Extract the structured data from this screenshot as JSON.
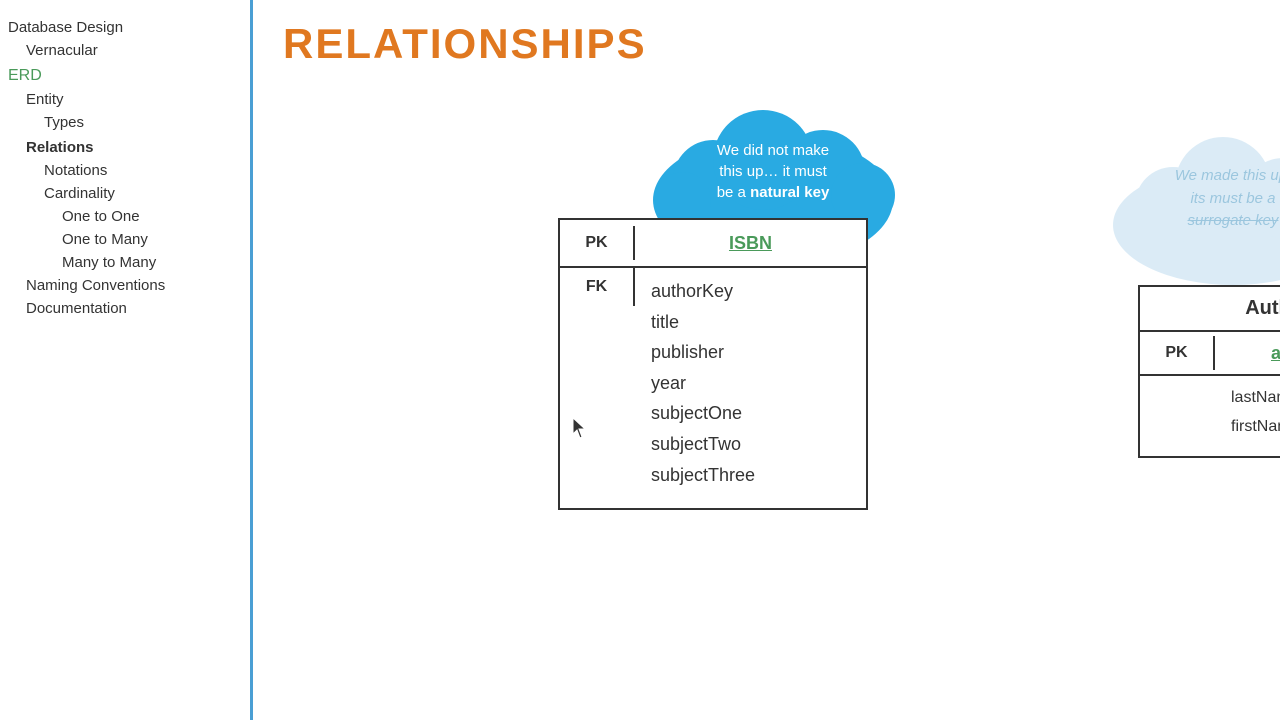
{
  "sidebar": {
    "items": [
      {
        "label": "Database Design",
        "level": 0,
        "style": "normal"
      },
      {
        "label": "Vernacular",
        "level": 1,
        "style": "normal"
      },
      {
        "label": "ERD",
        "level": 0,
        "style": "green"
      },
      {
        "label": "Entity",
        "level": 1,
        "style": "normal"
      },
      {
        "label": "Types",
        "level": 2,
        "style": "normal"
      },
      {
        "label": "Relations",
        "level": 1,
        "style": "active"
      },
      {
        "label": "Notations",
        "level": 2,
        "style": "normal"
      },
      {
        "label": "Cardinality",
        "level": 2,
        "style": "normal"
      },
      {
        "label": "One to One",
        "level": 3,
        "style": "normal"
      },
      {
        "label": "One to Many",
        "level": 3,
        "style": "normal"
      },
      {
        "label": "Many to Many",
        "level": 3,
        "style": "normal"
      },
      {
        "label": "Naming Conventions",
        "level": 1,
        "style": "normal"
      },
      {
        "label": "Documentation",
        "level": 1,
        "style": "normal"
      }
    ]
  },
  "main": {
    "title": "RELATIONSHIPS",
    "cloud_left": {
      "line1": "We did not make",
      "line2": "this up… it must",
      "line3": "be a",
      "bold": "natural key"
    },
    "cloud_right": {
      "line1": "We made this up,",
      "line2": "its must be a",
      "line3_strike": "surrogate key"
    },
    "table_left": {
      "pk_label": "PK",
      "pk_value": "ISBN",
      "fk_label": "FK",
      "fields": [
        "authorKey",
        "title",
        "publisher",
        "year",
        "subjectOne",
        "subjectTwo",
        "subjectThree"
      ]
    },
    "table_right": {
      "title": "Author",
      "pk_label": "PK",
      "pk_value": "authorKey",
      "fields": [
        "lastName",
        "firstName"
      ]
    }
  }
}
